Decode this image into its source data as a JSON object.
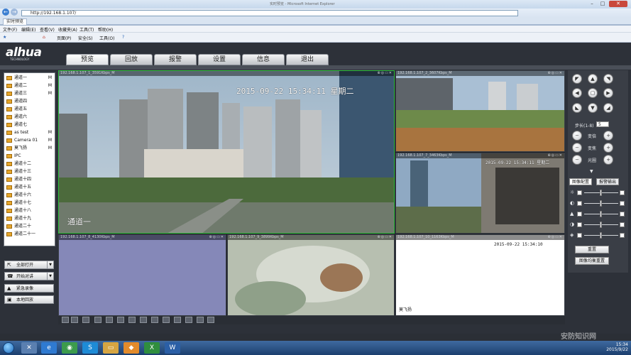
{
  "browser": {
    "address": "http://192.168.1.107/",
    "tab_title": "实时预览",
    "window_title": "实时预览 - Microsoft Internet Explorer",
    "menus": [
      "文件(F)",
      "编辑(E)",
      "查看(V)",
      "收藏夹(A)",
      "工具(T)",
      "帮助(H)"
    ],
    "commands": [
      "页面(P)",
      "安全(S)",
      "工具(O)"
    ]
  },
  "app": {
    "logo": "alhua",
    "logo_sub": "TECHNOLOGY",
    "nav": [
      "预览",
      "回放",
      "报警",
      "设置",
      "信息",
      "退出"
    ],
    "active_nav": "预览"
  },
  "channels": [
    {
      "name": "通道一",
      "flag": "M"
    },
    {
      "name": "通道二",
      "flag": "M"
    },
    {
      "name": "通道三",
      "flag": "M"
    },
    {
      "name": "通道四",
      "flag": ""
    },
    {
      "name": "通道五",
      "flag": ""
    },
    {
      "name": "通道六",
      "flag": ""
    },
    {
      "name": "通道七",
      "flag": ""
    },
    {
      "name": "as test",
      "flag": "M"
    },
    {
      "name": "Camera 01",
      "flag": "M"
    },
    {
      "name": "莫飞扬",
      "flag": "M"
    },
    {
      "name": "IPC",
      "flag": ""
    },
    {
      "name": "通道十二",
      "flag": ""
    },
    {
      "name": "通道十三",
      "flag": ""
    },
    {
      "name": "通道十四",
      "flag": ""
    },
    {
      "name": "通道十五",
      "flag": ""
    },
    {
      "name": "通道十六",
      "flag": ""
    },
    {
      "name": "通道十七",
      "flag": ""
    },
    {
      "name": "通道十八",
      "flag": ""
    },
    {
      "name": "通道十九",
      "flag": ""
    },
    {
      "name": "通道二十",
      "flag": ""
    },
    {
      "name": "通道二十一",
      "flag": ""
    }
  ],
  "left_buttons": {
    "open_all": "全部打开",
    "start_talk": "开始对讲",
    "emergency_record": "紧急录像",
    "local_playback": "本地回放"
  },
  "cells": [
    {
      "header": "192.168.1.107_1_3591Kbps_M",
      "osd_time": "2015-09-22  15:34:11  星期二",
      "osd_name": "通道一"
    },
    {
      "header": "192.168.1.107_2_3607Kbps_M",
      "osd_time": "",
      "osd_name": ""
    },
    {
      "header": "192.168.1.107_7_3463Kbps_M",
      "osd_time": "2015-09-22  15:34:11  星期二",
      "osd_name": ""
    },
    {
      "header": "192.168.1.107_8_4130Kbps_M",
      "osd_time": "",
      "osd_name": ""
    },
    {
      "header": "192.168.1.107_9_3899Kbps_M",
      "osd_time": "",
      "osd_name": ""
    },
    {
      "header": "192.168.1.107_10_1163Kbps_M",
      "osd_time": "2015-09-22  15:34:10",
      "osd_name": "莫飞扬"
    }
  ],
  "ptz": {
    "step_label": "步长(1-8)",
    "step_value": "5",
    "zoom_label": "变倍",
    "focus_label": "变焦",
    "iris_label": "光圈"
  },
  "image_panel": {
    "tab_image": "图像配置",
    "tab_alarm": "报警输出",
    "reset_label": "重置",
    "restore_label": "图像均衡重置"
  },
  "taskbar": {
    "time": "15:34",
    "date": "2015/9/22"
  },
  "watermark": "安防知识网"
}
